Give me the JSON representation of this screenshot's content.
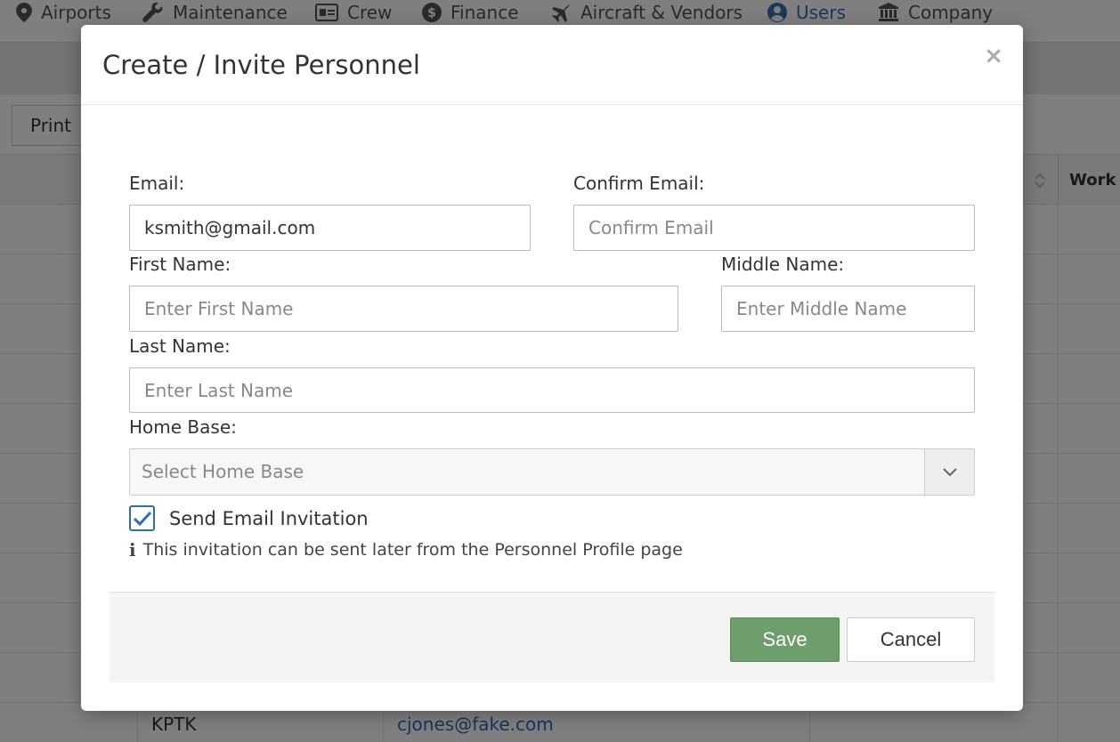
{
  "nav": {
    "items": [
      {
        "label": "Airports",
        "icon": "map-pin-icon"
      },
      {
        "label": "Maintenance",
        "icon": "wrench-icon"
      },
      {
        "label": "Crew",
        "icon": "id-card-icon"
      },
      {
        "label": "Finance",
        "icon": "dollar-circle-icon"
      },
      {
        "label": "Aircraft & Vendors",
        "icon": "plane-icon"
      },
      {
        "label": "Users",
        "icon": "user-circle-icon",
        "active": true
      },
      {
        "label": "Company",
        "icon": "bank-icon"
      }
    ]
  },
  "toolbar": {
    "print_label": "Print"
  },
  "table": {
    "header_work": "Work",
    "last_row": {
      "base": "KPTK",
      "email": "cjones@fake.com"
    }
  },
  "modal": {
    "title": "Create / Invite Personnel",
    "close_symbol": "×",
    "email": {
      "label": "Email:",
      "value": "ksmith@gmail.com"
    },
    "confirm_email": {
      "label": "Confirm Email:",
      "placeholder": "Confirm Email"
    },
    "first_name": {
      "label": "First Name:",
      "placeholder": "Enter First Name"
    },
    "middle_name": {
      "label": "Middle Name:",
      "placeholder": "Enter Middle Name"
    },
    "last_name": {
      "label": "Last Name:",
      "placeholder": "Enter Last Name"
    },
    "home_base": {
      "label": "Home Base:",
      "placeholder": "Select Home Base"
    },
    "send_invite": {
      "label": "Send Email Invitation",
      "checked": true
    },
    "info_text": "This invitation can be sent later from the Personnel Profile page",
    "save_label": "Save",
    "cancel_label": "Cancel"
  },
  "colors": {
    "accent": "#2f6db3",
    "save_green": "#6f9e6d",
    "overlay": "rgba(0,0,0,0.5)"
  }
}
